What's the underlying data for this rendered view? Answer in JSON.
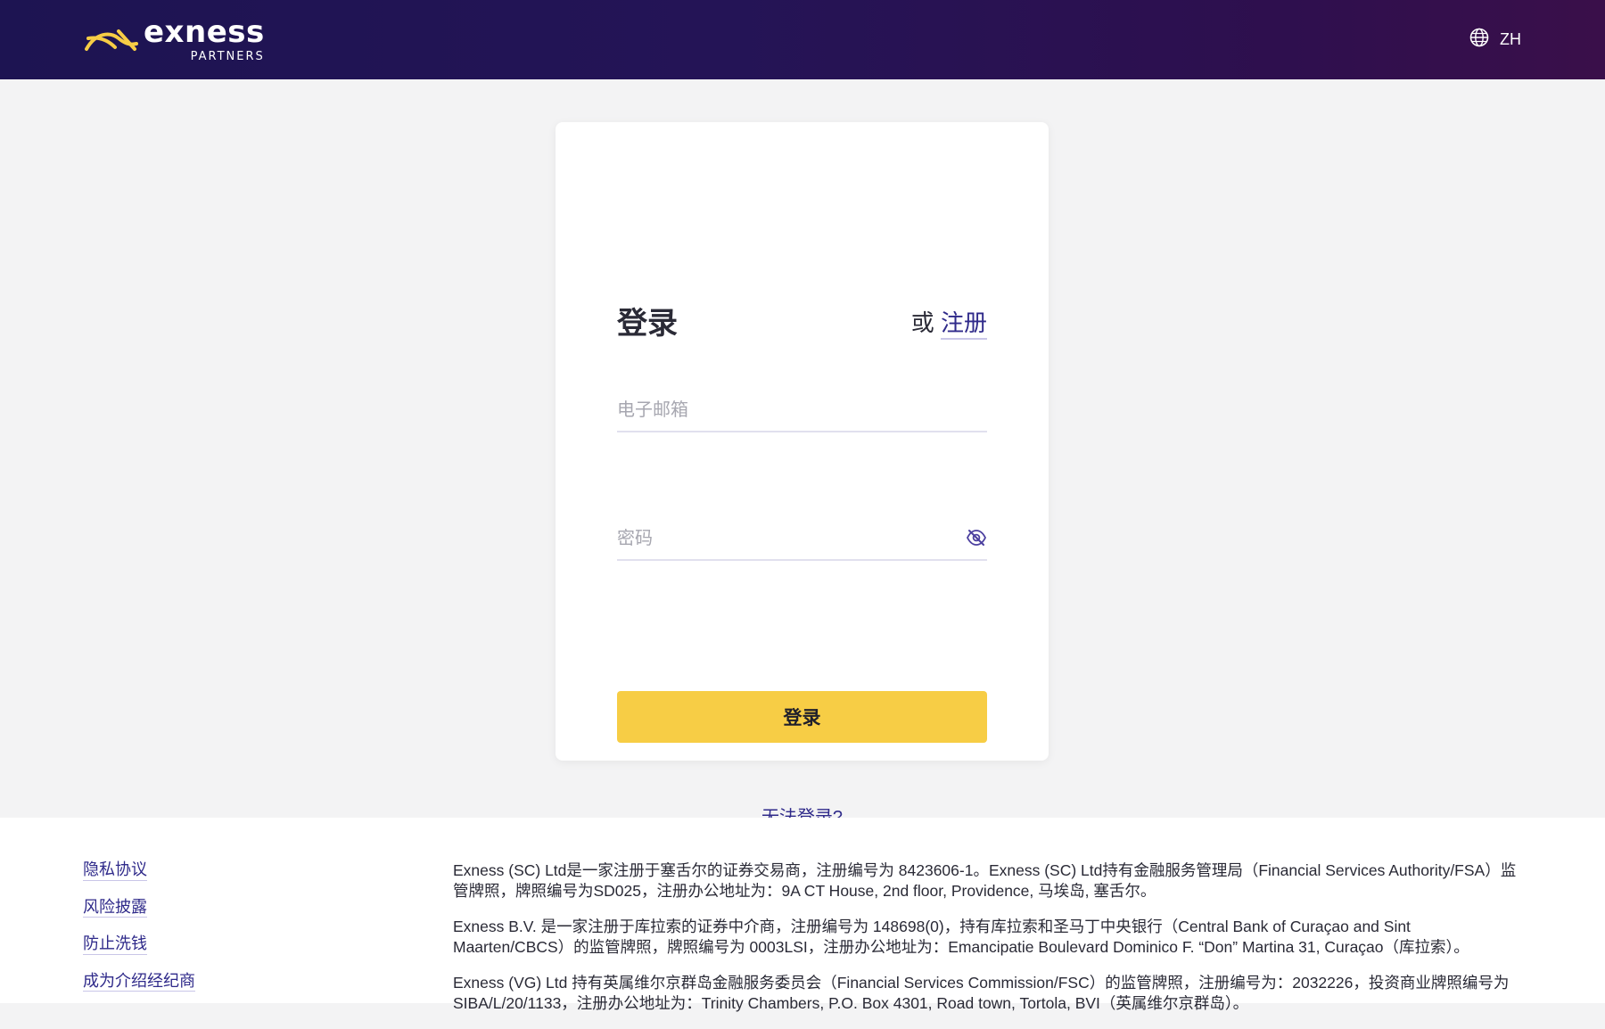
{
  "header": {
    "logo_word": "exness",
    "logo_sub": "PARTNERS",
    "language": "ZH"
  },
  "login": {
    "title": "登录",
    "or_label": "或",
    "register_link": "注册",
    "email_placeholder": "电子邮箱",
    "email_value": "",
    "password_placeholder": "密码",
    "password_value": "",
    "submit_label": "登录",
    "cant_login_link": "无法登录?"
  },
  "footer": {
    "links": [
      "隐私协议",
      "风险披露",
      "防止洗钱",
      "成为介绍经纪商"
    ],
    "paragraphs": [
      "Exness (SC) Ltd是一家注册于塞舌尔的证券交易商，注册编号为 8423606-1。Exness (SC) Ltd持有金融服务管理局（Financial Services Authority/FSA）监管牌照，牌照编号为SD025，注册办公地址为：9A CT House, 2nd floor, Providence, 马埃岛, 塞舌尔。",
      "Exness B.V. 是一家注册于库拉索的证券中介商，注册编号为 148698(0)，持有库拉索和圣马丁中央银行（Central Bank of Curaçao and Sint Maarten/CBCS）的监管牌照，牌照编号为 0003LSI，注册办公地址为：Emancipatie Boulevard Dominico F. “Don” Martina 31, Curaçao（库拉索）。",
      "Exness (VG) Ltd 持有英属维尔京群岛金融服务委员会（Financial Services Commission/FSC）的监管牌照，注册编号为：2032226，投资商业牌照编号为 SIBA/L/20/1133，注册办公地址为：Trinity Chambers, P.O. Box 4301, Road town, Tortola, BVI（英属维尔京群岛）。"
    ]
  },
  "colors": {
    "header_start": "#1d1452",
    "header_end": "#3a0f4a",
    "accent_yellow": "#f7cd45",
    "link": "#2f2a8a"
  }
}
